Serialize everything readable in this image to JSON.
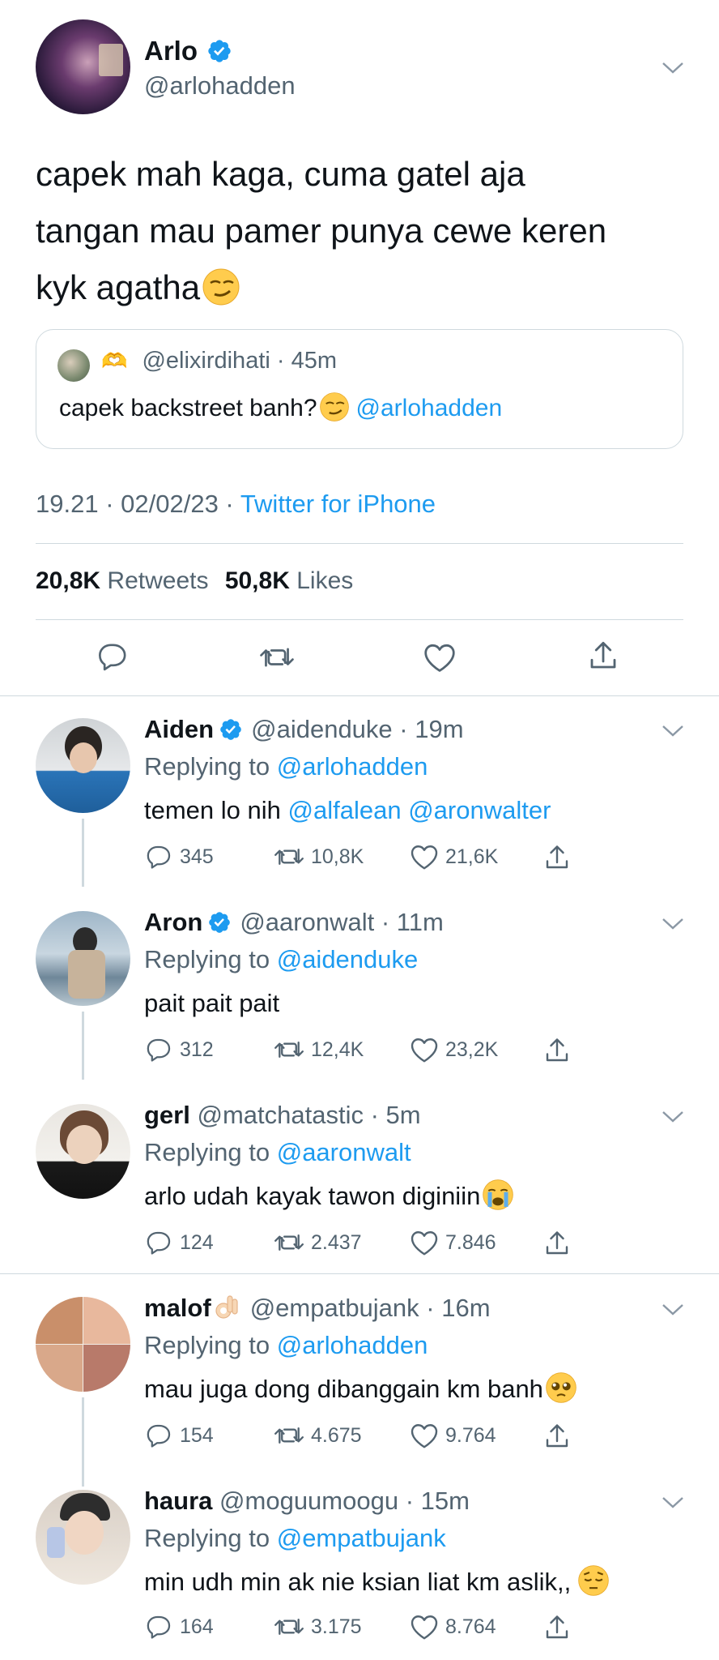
{
  "main": {
    "author_name": "Arlo",
    "author_handle": "@arlohadden",
    "text_line1": "capek mah kaga, cuma gatel aja",
    "text_line2": "tangan mau pamer punya cewe keren",
    "text_line3": "kyk agatha",
    "quote": {
      "heart_hands": "🫶",
      "handle": "@elixirdihati",
      "time": "45m",
      "text": "capek backstreet banh?",
      "mention": "@arlohadden"
    },
    "meta_time": "19.21",
    "meta_date": "02/02/23",
    "meta_source": "Twitter for iPhone",
    "retweets_count": "20,8K",
    "retweets_label": "Retweets",
    "likes_count": "50,8K",
    "likes_label": "Likes"
  },
  "replies": [
    {
      "name": "Aiden",
      "handle": "@aidenduke",
      "time": "19m",
      "replying_label": "Replying to",
      "replying_to": "@arlohadden",
      "text": "temen lo nih",
      "mentions": "@alfalean @aronwalter",
      "reply_count": "345",
      "retweet_count": "10,8K",
      "like_count": "21,6K"
    },
    {
      "name": "Aron",
      "handle": "@aaronwalt",
      "time": "11m",
      "replying_label": "Replying to",
      "replying_to": "@aidenduke",
      "text": "pait pait pait",
      "reply_count": "312",
      "retweet_count": "12,4K",
      "like_count": "23,2K"
    },
    {
      "name": "gerl",
      "handle": "@matchatastic",
      "time": "5m",
      "replying_label": "Replying to",
      "replying_to": "@aaronwalt",
      "text": "arlo udah kayak tawon diginiin",
      "reply_count": "124",
      "retweet_count": "2.437",
      "like_count": "7.846"
    },
    {
      "name": "malof",
      "handle": "@empatbujank",
      "time": "16m",
      "replying_label": "Replying to",
      "replying_to": "@arlohadden",
      "text": "mau juga dong dibanggain km banh",
      "reply_count": "154",
      "retweet_count": "4.675",
      "like_count": "9.764"
    },
    {
      "name": "haura",
      "handle": "@moguumoogu",
      "time": "15m",
      "replying_label": "Replying to",
      "replying_to": "@empatbujank",
      "text": "min udh min ak nie ksian liat km aslik,,",
      "reply_count": "164",
      "retweet_count": "3.175",
      "like_count": "8.764"
    }
  ],
  "colors": {
    "accent": "#1d9bf0",
    "text": "#0f1419",
    "secondary": "#536471",
    "divider": "#cfd9de"
  }
}
